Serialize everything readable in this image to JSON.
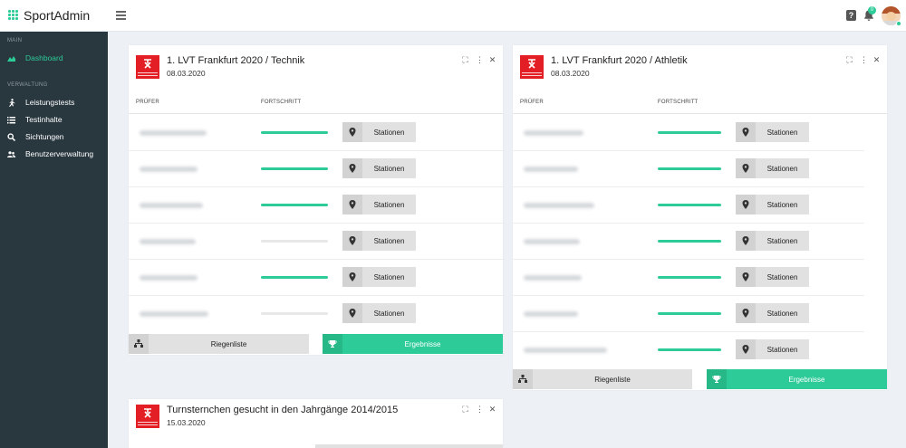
{
  "app": {
    "brand": "SportAdmin",
    "notification_count": "0"
  },
  "sidebar": {
    "sections": [
      {
        "label": "MAIN",
        "items": [
          {
            "label": "Dashboard",
            "icon": "chart-area-icon",
            "active": true
          }
        ]
      },
      {
        "label": "VERWALTUNG",
        "items": [
          {
            "label": "Leistungstests",
            "icon": "running-icon"
          },
          {
            "label": "Testinhalte",
            "icon": "list-icon"
          },
          {
            "label": "Sichtungen",
            "icon": "search-icon"
          },
          {
            "label": "Benutzerverwaltung",
            "icon": "users-icon"
          }
        ]
      }
    ]
  },
  "colors": {
    "accent": "#2dcb97",
    "sidebar_bg": "#29373f",
    "logo_red": "#e31e24"
  },
  "cards": [
    {
      "title": "1. LVT Frankfurt 2020 / Technik",
      "date": "08.03.2020",
      "col_examiner": "PRÜFER",
      "col_progress": "FORTSCHRITT",
      "station_label": "Stationen",
      "rows": [
        {
          "progress": 1.0
        },
        {
          "progress": 1.0
        },
        {
          "progress": 1.0
        },
        {
          "progress": 0.0
        },
        {
          "progress": 1.0
        },
        {
          "progress": 0.0
        }
      ],
      "riegen_label": "Riegenliste",
      "results_label": "Ergebnisse"
    },
    {
      "title": "1. LVT Frankfurt 2020 / Athletik",
      "date": "08.03.2020",
      "col_examiner": "PRÜFER",
      "col_progress": "FORTSCHRITT",
      "station_label": "Stationen",
      "rows": [
        {
          "progress": 1.0
        },
        {
          "progress": 1.0
        },
        {
          "progress": 1.0
        },
        {
          "progress": 1.0
        },
        {
          "progress": 1.0
        },
        {
          "progress": 1.0
        },
        {
          "progress": 1.0
        }
      ],
      "riegen_label": "Riegenliste",
      "results_label": "Ergebnisse"
    },
    {
      "title": "Turnsternchen gesucht in den Jahrgänge 2014/2015",
      "date": "15.03.2020"
    }
  ]
}
